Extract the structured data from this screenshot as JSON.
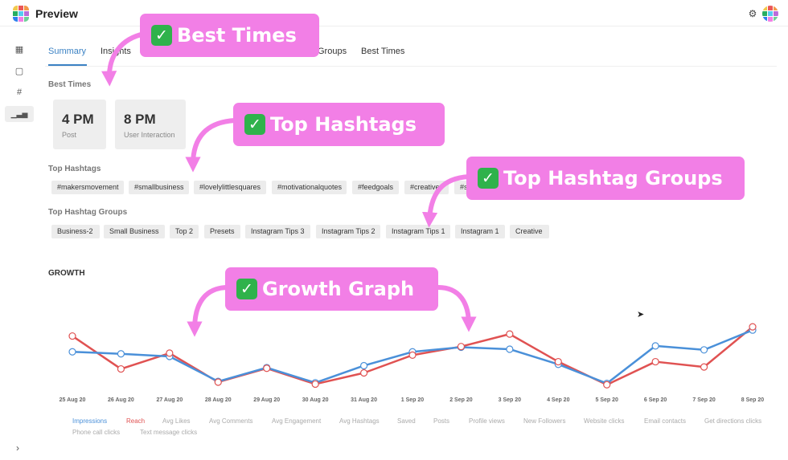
{
  "app": {
    "title": "Preview"
  },
  "colors": {
    "accent": "#3b82c4",
    "callout": "#f27fe6",
    "impressions": "#4a90d9",
    "reach": "#e05252",
    "check": "#2fb24b"
  },
  "logo_colors": [
    "#f2c94c",
    "#eb5757",
    "#f2994a",
    "#27ae60",
    "#56ccf2",
    "#bb6bd9",
    "#2f80ed",
    "#f27fe6",
    "#6fcf97"
  ],
  "header": {
    "settings_icon": "gear-icon",
    "avatar_icon": "avatar-icon"
  },
  "sidebar": {
    "items": [
      {
        "icon": "grid-icon",
        "glyph": "▦"
      },
      {
        "icon": "calendar-icon",
        "glyph": "▢"
      },
      {
        "icon": "hashtag-icon",
        "glyph": "#"
      },
      {
        "icon": "analytics-icon",
        "glyph": "📊"
      }
    ],
    "expand_glyph": "›"
  },
  "tabs": [
    {
      "label": "Summary",
      "active": true
    },
    {
      "label": "Insights",
      "active": false
    },
    {
      "label": "Groups",
      "active": false
    },
    {
      "label": "Best Times",
      "active": false
    }
  ],
  "best_times": {
    "label": "Best Times",
    "cards": [
      {
        "time": "4 PM",
        "sub": "Post"
      },
      {
        "time": "8 PM",
        "sub": "User Interaction"
      }
    ]
  },
  "top_hashtags": {
    "label": "Top Hashtags",
    "chips": [
      "#makersmovement",
      "#smallbusiness",
      "#lovelylittlesquares",
      "#motivationalquotes",
      "#feedgoals",
      "#creative",
      "#s"
    ]
  },
  "top_hashtag_groups": {
    "label": "Top Hashtag Groups",
    "chips": [
      "Business-2",
      "Small Business",
      "Top 2",
      "Presets",
      "Instagram Tips 3",
      "Instagram Tips 2",
      "Instagram Tips 1",
      "Instagram 1",
      "Creative"
    ]
  },
  "growth": {
    "label": "GROWTH"
  },
  "callouts": {
    "check_glyph": "✓",
    "best_times": "Best Times",
    "top_hashtags": "Top Hashtags",
    "top_hashtag_groups": "Top Hashtag Groups",
    "growth_graph": "Growth Graph"
  },
  "chart_data": {
    "type": "line",
    "x": [
      "25 Aug 20",
      "26 Aug 20",
      "27 Aug 20",
      "28 Aug 20",
      "29 Aug 20",
      "30 Aug 20",
      "31 Aug 20",
      "1 Sep 20",
      "2 Sep 20",
      "3 Sep 20",
      "4 Sep 20",
      "5 Sep 20",
      "6 Sep 20",
      "7 Sep 20",
      "8 Sep 20"
    ],
    "series": [
      {
        "name": "Impressions",
        "color": "#4a90d9",
        "values": [
          57,
          54,
          50,
          12,
          33,
          10,
          36,
          57,
          64,
          61,
          38,
          9,
          66,
          60,
          90
        ]
      },
      {
        "name": "Reach",
        "color": "#e05252",
        "values": [
          81,
          31,
          55,
          11,
          32,
          8,
          25,
          52,
          65,
          84,
          42,
          7,
          42,
          34,
          95
        ]
      }
    ],
    "ylim": [
      0,
      100
    ],
    "grid": false,
    "legend": [
      "Impressions",
      "Reach",
      "Avg Likes",
      "Avg Comments",
      "Avg Engagement",
      "Avg Hashtags",
      "Saved",
      "Posts",
      "Profile views",
      "New Followers",
      "Website clicks",
      "Email contacts",
      "Get directions clicks",
      "Phone call clicks",
      "Text message clicks"
    ],
    "legend_placement": "bottom"
  }
}
